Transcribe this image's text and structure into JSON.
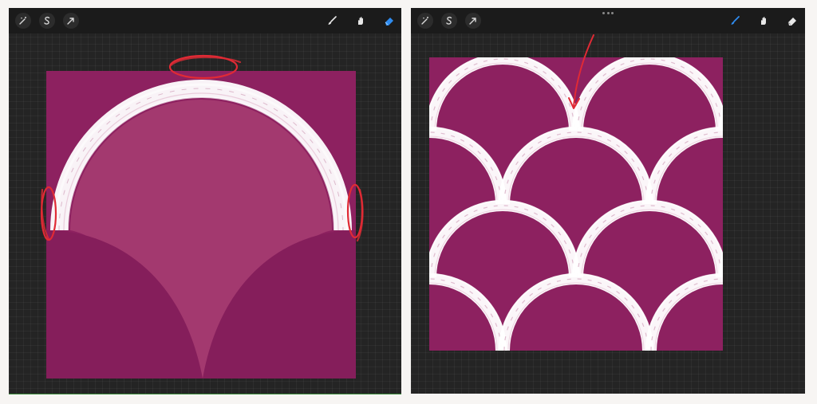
{
  "colors": {
    "app_background": "#f7f5f3",
    "panel_background": "#242424",
    "toolbar_background": "#1b1b1b",
    "canvas_fill": "#8d2160",
    "inner_arch_fill": "#a3396f",
    "brush_stroke": "#ffffff",
    "annotation_red": "#e02a35",
    "active_tool": "#2f8cf0"
  },
  "left_panel": {
    "toolbar": {
      "left_tools": [
        "magic-wand-icon",
        "selection-s-icon",
        "transform-arrow-icon"
      ],
      "right_tools": [
        "brush-icon",
        "smudge-icon",
        "eraser-icon"
      ],
      "active_tool": "eraser-icon"
    }
  },
  "right_panel": {
    "toolbar": {
      "left_tools": [
        "magic-wand-icon",
        "selection-s-icon",
        "transform-arrow-icon"
      ],
      "right_tools": [
        "brush-icon",
        "smudge-icon",
        "eraser-icon"
      ],
      "active_tool": "brush-icon",
      "top_handle": "more-dots-icon"
    }
  }
}
